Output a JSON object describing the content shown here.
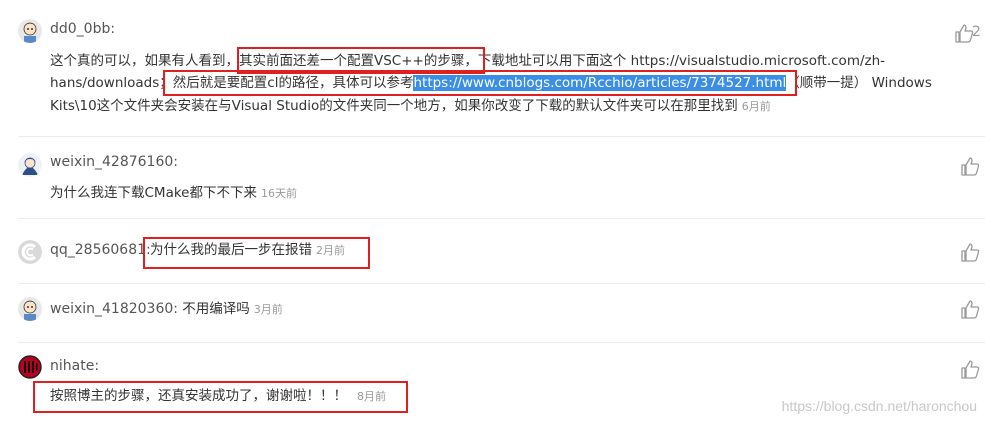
{
  "comments": [
    {
      "username": "dd0_0bb:",
      "likes": "2",
      "line1": {
        "pre": "这个真的可以，如果有人看到，",
        "boxed": "其实前面还差一个配置VSC++的步骤，",
        "post": "下载地址可以用下面这个 https://visualstudio.microsoft.com/zh-"
      },
      "line2": {
        "pre": "hans/downloads",
        "boxed_text": "；然后就是要配置cl的路径，具体可以参考",
        "link": "https://www.cnblogs.com/Rcchio/articles/7374527.html",
        "post": "（顺带一提） Windows"
      },
      "line3": {
        "text": "Kits\\10这个文件夹会安装在与Visual Studio的文件夹同一个地方，如果你改变了下载的默认文件夹可以在那里找到",
        "time": "6月前"
      }
    },
    {
      "username": "weixin_42876160:",
      "text": "为什么我连下载CMake都下不下来",
      "time": "16天前"
    },
    {
      "username": "qq_28560681:",
      "text": "为什么我的最后一步在报错",
      "time": "2月前"
    },
    {
      "username": "weixin_41820360:",
      "text": "不用编译吗",
      "time": "3月前"
    },
    {
      "username": "nihate:",
      "text": "按照博主的步骤，还真安装成功了，谢谢啦！！！",
      "time": "8月前"
    }
  ],
  "watermark": "https://blog.csdn.net/haronchou",
  "icons": {
    "like": "thumbs-up-icon",
    "avatar": "avatar-icon"
  },
  "colors": {
    "annotation_red": "#e02020",
    "link_highlight": "#3a8ee6",
    "muted": "#999999"
  }
}
